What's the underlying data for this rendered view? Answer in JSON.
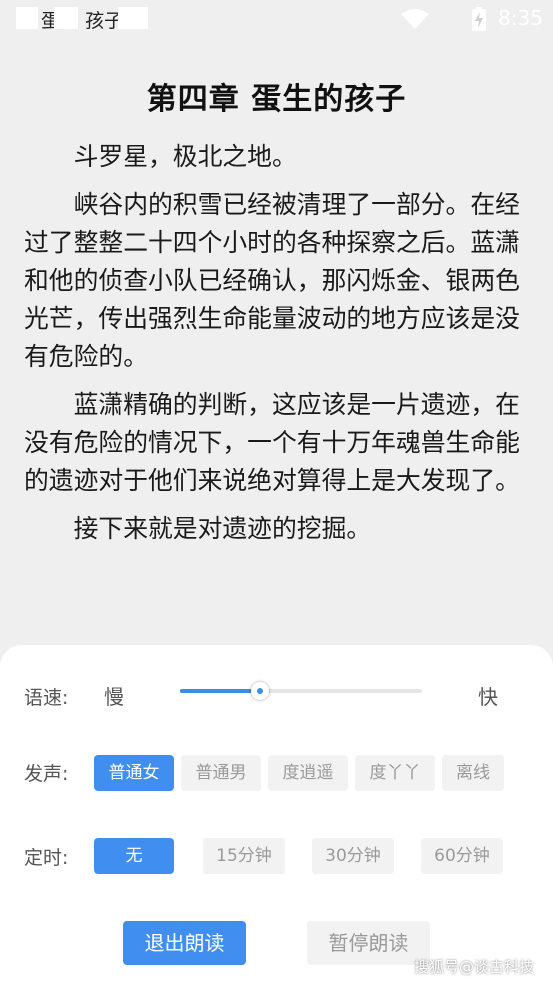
{
  "status_bar": {
    "app_title": "凹 蛋生 孩子",
    "time": "8:35",
    "wifi_icon": "wifi-icon",
    "battery_icon": "battery-charging-icon"
  },
  "reader": {
    "chapter_title": "第四章 蛋生的孩子",
    "paragraphs": [
      "斗罗星，极北之地。",
      "峡谷内的积雪已经被清理了一部分。在经过了整整二十四个小时的各种探察之后。蓝潇和他的侦查小队已经确认，那闪烁金、银两色光芒，传出强烈生命能量波动的地方应该是没有危险的。",
      "蓝潇精确的判断，这应该是一片遗迹，在没有危险的情况下，一个有十万年魂兽生命能的遗迹对于他们来说绝对算得上是大发现了。",
      "接下来就是对遗迹的挖掘。"
    ]
  },
  "tts_panel": {
    "speed": {
      "label": "语速:",
      "slow": "慢",
      "fast": "快",
      "value": 0.33
    },
    "voice": {
      "label": "发声:",
      "options": [
        "普通女",
        "普通男",
        "度逍遥",
        "度丫丫",
        "离线"
      ],
      "selected": "普通女"
    },
    "timer": {
      "label": "定时:",
      "options": [
        "无",
        "15分钟",
        "30分钟",
        "60分钟"
      ],
      "selected": "无"
    },
    "exit_button": "退出朗读",
    "pause_button": "暂停朗读",
    "watermark": "搜狐号@谈古科技"
  },
  "colors": {
    "accent": "#3f8ef0",
    "page_bg": "#efefef",
    "panel_bg": "#ffffff"
  }
}
